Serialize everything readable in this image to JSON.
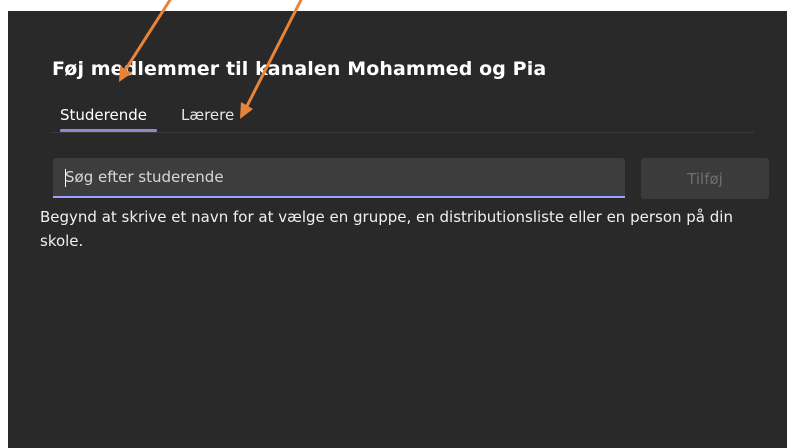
{
  "dialog": {
    "title": "Føj medlemmer til kanalen Mohammed og Pia",
    "tabs": [
      {
        "label": "Studerende",
        "active": true
      },
      {
        "label": "Lærere",
        "active": false
      }
    ],
    "search": {
      "placeholder": "Søg efter studerende",
      "value": ""
    },
    "add_button_label": "Tilføj",
    "hint_text": "Begynd at skrive et navn for at vælge en gruppe, en distributionsliste eller en person på din skole."
  },
  "colors": {
    "dialog_bg": "#292929",
    "accent": "#9ea2ff",
    "annotation_arrow": "#e8843a"
  },
  "annotations": [
    {
      "name": "annotation-arrow-1",
      "points_to": "tab-studerende"
    },
    {
      "name": "annotation-arrow-2",
      "points_to": "tab-laerere"
    }
  ]
}
